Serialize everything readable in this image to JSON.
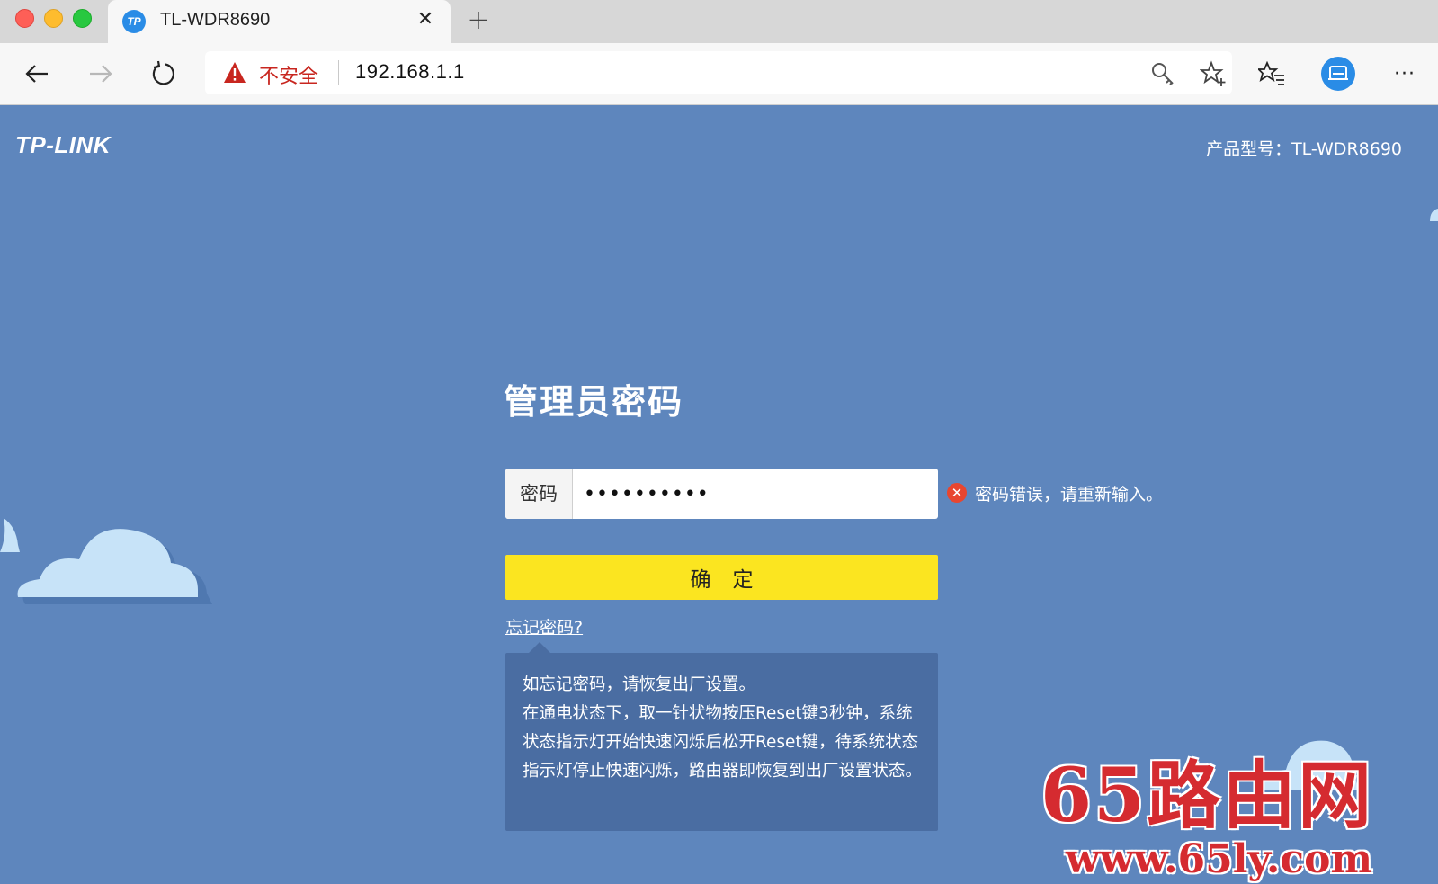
{
  "browser": {
    "tab": {
      "favicon_text": "TP",
      "title": "TL-WDR8690",
      "close": "✕"
    },
    "new_tab": "+",
    "security_label": "不安全",
    "url": "192.168.1.1",
    "icons": [
      "back-arrow-icon",
      "forward-arrow-icon",
      "reload-icon",
      "warning-icon",
      "key-icon",
      "add-favorite-icon",
      "favorites-icon",
      "profile-icon",
      "more-icon"
    ],
    "more_label": "···"
  },
  "header": {
    "logo": "TP-LINK",
    "model": "产品型号：TL-WDR8690"
  },
  "login": {
    "title": "管理员密码",
    "password_label": "密码",
    "password_value": "••••••••••",
    "error_icon": "✕",
    "error_text": "密码错误，请重新输入。",
    "confirm_label": "确定",
    "forgot_link": "忘记密码?",
    "tip": "如忘记密码，请恢复出厂设置。\n在通电状态下，取一针状物按压Reset键3秒钟，系统状态指示灯开始快速闪烁后松开Reset键，待系统状态指示灯停止快速闪烁，路由器即恢复到出厂设置状态。"
  },
  "watermark": {
    "main": "65路由网",
    "url": "www.65ly.com"
  },
  "colors": {
    "page_bg": "#5e86bd",
    "button": "#fbe520",
    "tip_bg": "#4a6da2",
    "error": "#e8462f",
    "insecure": "#c8261f",
    "watermark": "#d52b30"
  }
}
